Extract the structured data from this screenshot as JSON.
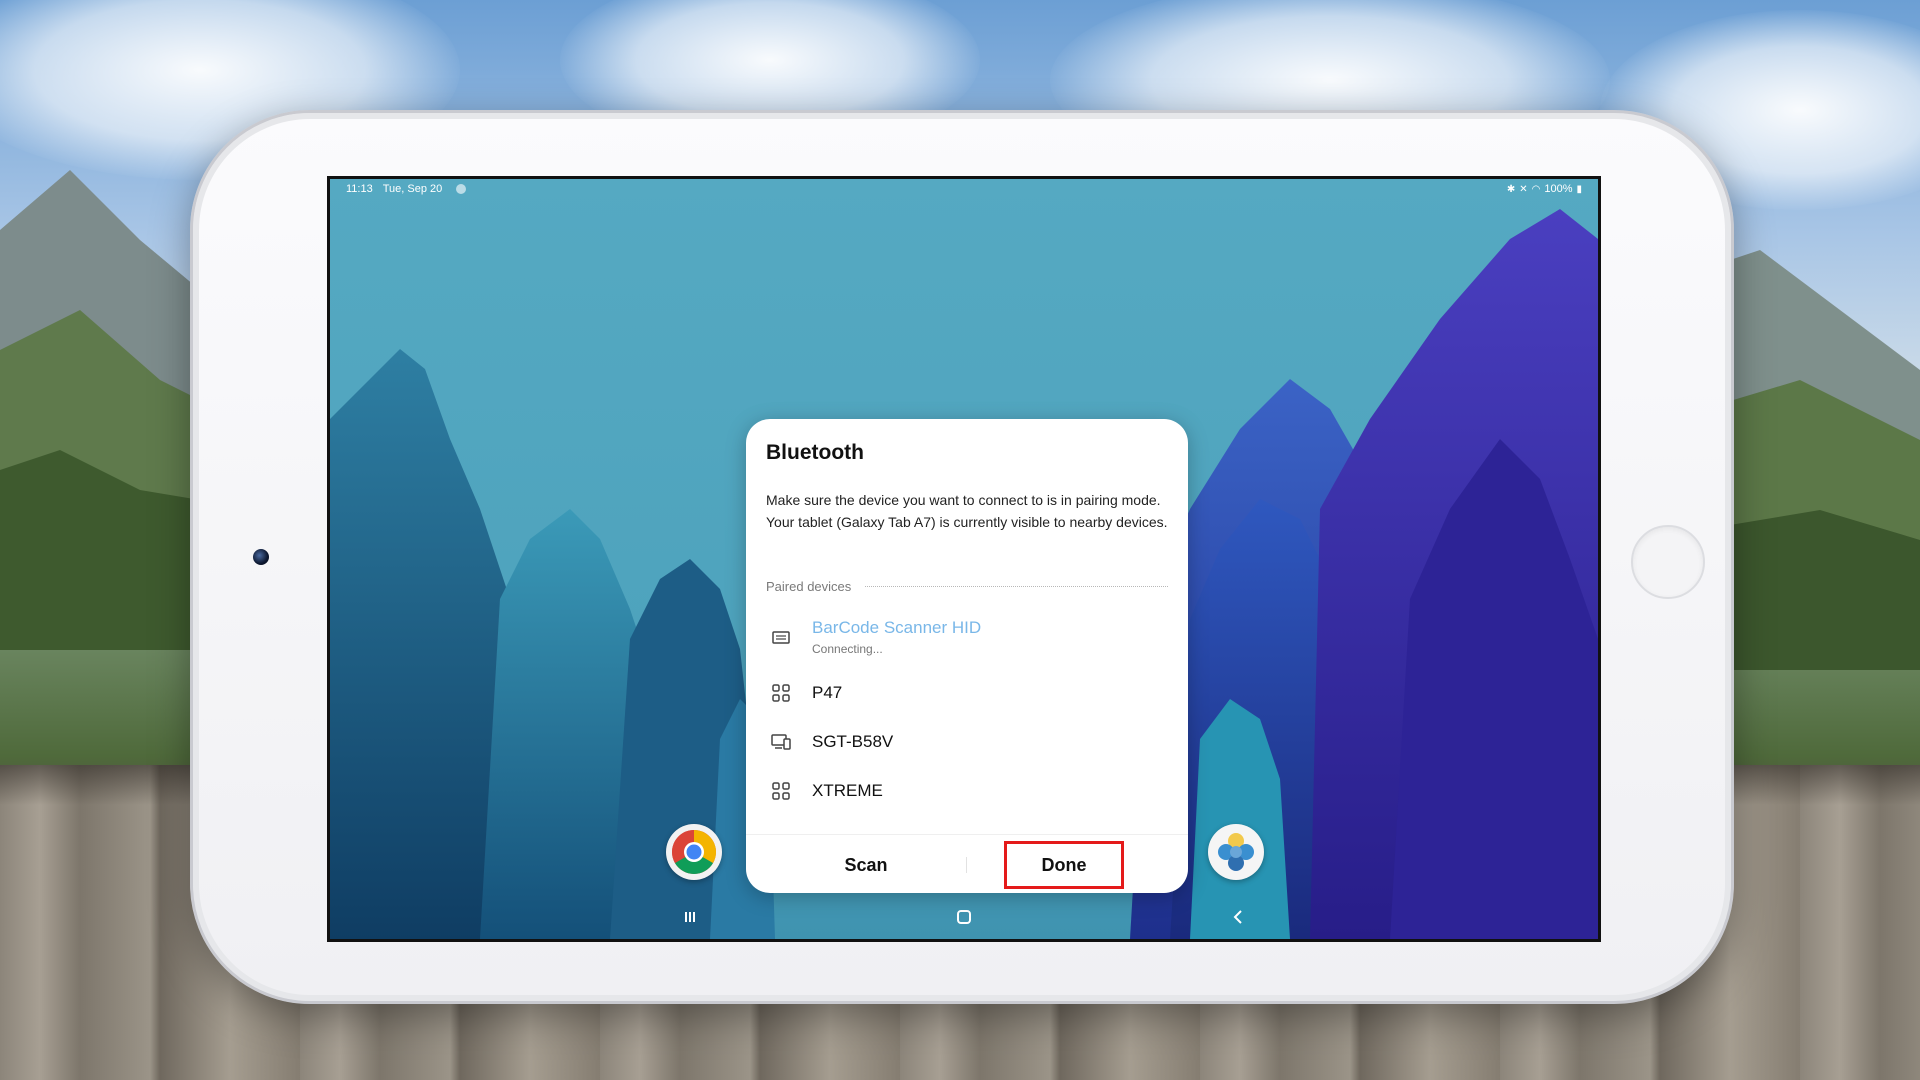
{
  "status_bar": {
    "time": "11:13",
    "date": "Tue, Sep 20",
    "battery": "100%"
  },
  "dialog": {
    "title": "Bluetooth",
    "description": "Make sure the device you want to connect to is in pairing mode. Your tablet (Galaxy Tab A7) is currently visible to nearby devices.",
    "section_header": "Paired devices",
    "devices": [
      {
        "name": "BarCode Scanner HID",
        "status": "Connecting...",
        "icon": "keyboard-icon"
      },
      {
        "name": "P47",
        "status": "",
        "icon": "grid-device-icon"
      },
      {
        "name": "SGT-B58V",
        "status": "",
        "icon": "computer-phone-icon"
      },
      {
        "name": "XTREME",
        "status": "",
        "icon": "grid-device-icon"
      }
    ],
    "scan_label": "Scan",
    "done_label": "Done"
  },
  "apps": {
    "left": "chrome-icon",
    "right": "photos-icon"
  },
  "colors": {
    "highlight": "#e41a1a",
    "connecting_text": "#79b7e8",
    "wallpaper": "#55a9c2"
  }
}
